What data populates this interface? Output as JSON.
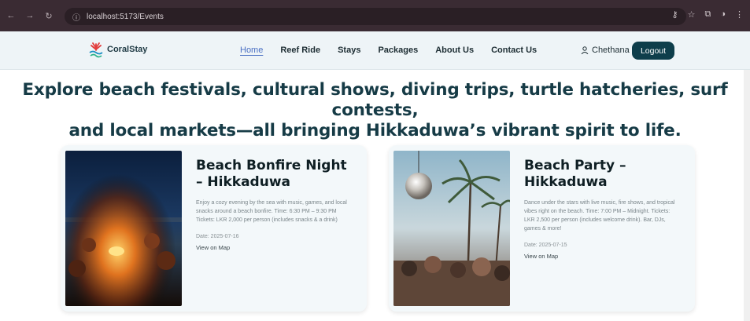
{
  "browser": {
    "url": "localhost:5173/Events"
  },
  "header": {
    "brand": "CoralStay",
    "menu": [
      {
        "label": "Home",
        "active": true
      },
      {
        "label": "Reef Ride",
        "active": false
      },
      {
        "label": "Stays",
        "active": false
      },
      {
        "label": "Packages",
        "active": false
      },
      {
        "label": "About Us",
        "active": false
      },
      {
        "label": "Contact Us",
        "active": false
      }
    ],
    "user_name": "Chethana",
    "logout_label": "Logout"
  },
  "hero": {
    "line1": "Explore beach festivals, cultural shows, diving trips, turtle hatcheries, surf contests,",
    "line2": "and local markets—all bringing Hikkaduwa’s vibrant spirit to life."
  },
  "events": [
    {
      "title": "Beach Bonfire Night – Hikkaduwa",
      "description": "Enjoy a cozy evening by the sea with music, games, and local snacks around a beach bonfire. Time: 6:30 PM – 9:30 PM Tickets: LKR 2,000 per person (includes snacks & a drink)",
      "date": "Date: 2025-07-16",
      "map_label": "View on Map"
    },
    {
      "title": "Beach Party – Hikkaduwa",
      "description": "Dance under the stars with live music, fire shows, and tropical vibes right on the beach. Time: 7:00 PM – Midnight. Tickets: LKR 2,500 per person (includes welcome drink). Bar, DJs, games & more!",
      "date": "Date: 2025-07-15",
      "map_label": "View on Map"
    }
  ],
  "colors": {
    "brand_dark": "#0e3e4b",
    "hero_text": "#163b46",
    "active_link": "#4a6fc3"
  }
}
